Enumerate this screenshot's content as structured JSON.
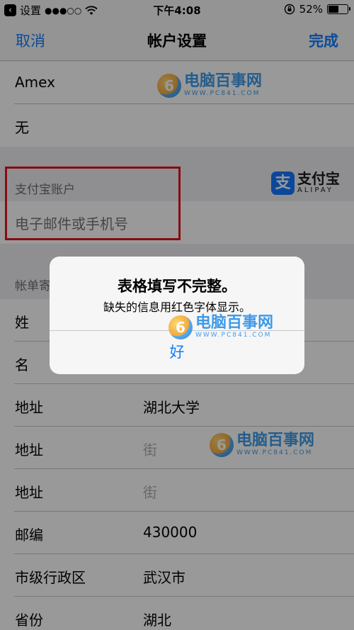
{
  "status_bar": {
    "back_app": "设置",
    "signal": "●●●○○",
    "time": "下午4:08",
    "battery": "52%",
    "battery_level": 0.52
  },
  "nav": {
    "cancel": "取消",
    "title": "帐户设置",
    "done": "完成"
  },
  "card": {
    "type": "Amex",
    "security_code": "无"
  },
  "alipay": {
    "header": "支付宝账户",
    "placeholder": "电子邮件或手机号",
    "logo_cn": "支付宝",
    "logo_en": "ALIPAY"
  },
  "billing": {
    "header": "帐单寄",
    "rows": [
      {
        "label": "姓",
        "value": ""
      },
      {
        "label": "名",
        "value": ""
      },
      {
        "label": "地址",
        "value": "湖北大学"
      },
      {
        "label": "地址",
        "value": "街"
      },
      {
        "label": "地址",
        "value": "街"
      },
      {
        "label": "邮编",
        "value": "430000"
      },
      {
        "label": "市级行政区",
        "value": "武汉市"
      },
      {
        "label": "省份",
        "value": "湖北"
      }
    ]
  },
  "watermark": {
    "cn": "电脑百事网",
    "en": "WWW.PC841.COM"
  },
  "alert": {
    "title": "表格填写不完整。",
    "message": "缺失的信息用红色字体显示。",
    "ok": "好"
  },
  "colors": {
    "accent": "#147efb",
    "highlight": "#e0141e",
    "alipay": "#1677ff"
  }
}
